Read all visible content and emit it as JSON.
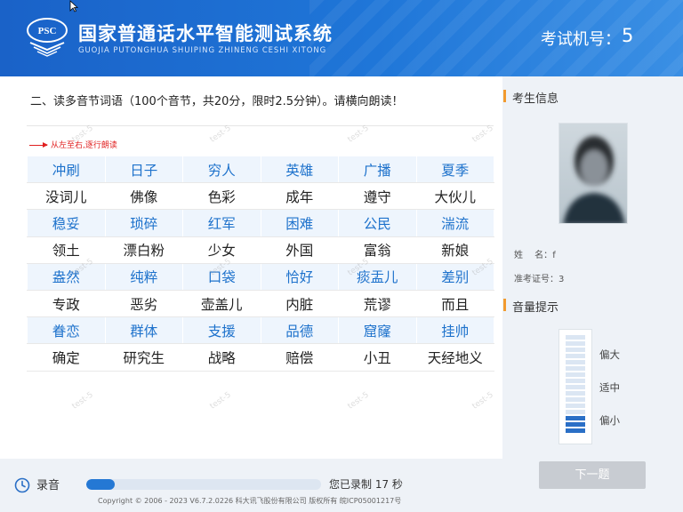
{
  "header": {
    "logo_text": "PSC",
    "title_cn": "国家普通话水平智能测试系统",
    "title_en": "GUOJIA PUTONGHUA SHUIPING ZHINENG CESHI XITONG",
    "machine_label": "考试机号：",
    "machine_value": "5"
  },
  "main": {
    "instruction": "二、读多音节词语（100个音节，共20分，限时2.5分钟）。请横向朗读！",
    "direction_hint": "从左至右,逐行朗读",
    "watermark": "test-5",
    "rows": [
      {
        "style": "blue",
        "words": [
          "冲刷",
          "日子",
          "穷人",
          "英雄",
          "广播",
          "夏季"
        ]
      },
      {
        "style": "black",
        "words": [
          "没词儿",
          "佛像",
          "色彩",
          "成年",
          "遵守",
          "大伙儿"
        ]
      },
      {
        "style": "blue",
        "words": [
          "稳妥",
          "琐碎",
          "红军",
          "困难",
          "公民",
          "湍流"
        ]
      },
      {
        "style": "black",
        "words": [
          "领土",
          "漂白粉",
          "少女",
          "外国",
          "富翁",
          "新娘"
        ]
      },
      {
        "style": "blue",
        "words": [
          "盎然",
          "纯粹",
          "口袋",
          "恰好",
          "痰盂儿",
          "差别"
        ]
      },
      {
        "style": "black",
        "words": [
          "专政",
          "恶劣",
          "壶盖儿",
          "内脏",
          "荒谬",
          "而且"
        ]
      },
      {
        "style": "blue",
        "words": [
          "眷恋",
          "群体",
          "支援",
          "品德",
          "窟窿",
          "挂帅"
        ]
      },
      {
        "style": "black",
        "words": [
          "确定",
          "研究生",
          "战略",
          "赔偿",
          "小丑",
          "天经地义"
        ]
      }
    ]
  },
  "sidebar": {
    "candidate_title": "考生信息",
    "name_label": "姓　 名：",
    "name_value": "f",
    "id_label": "准考证号：",
    "id_value": "3",
    "volume_title": "音量提示",
    "volume_high": "偏大",
    "volume_mid": "适中",
    "volume_low": "偏小",
    "volume_level": 0.2,
    "next_button": "下一题"
  },
  "bottom": {
    "record_label": "录音",
    "record_progress": 0.12,
    "record_status": "您已录制 17 秒",
    "copyright": "Copyright © 2006 - 2023 V6.7.2.0226 科大讯飞股份有限公司 版权所有 皖ICP05001217号"
  },
  "colors": {
    "header_blue": "#1f76d8",
    "word_blue": "#1e72cc",
    "accent_orange": "#f29a2e",
    "hint_red": "#e02020"
  }
}
